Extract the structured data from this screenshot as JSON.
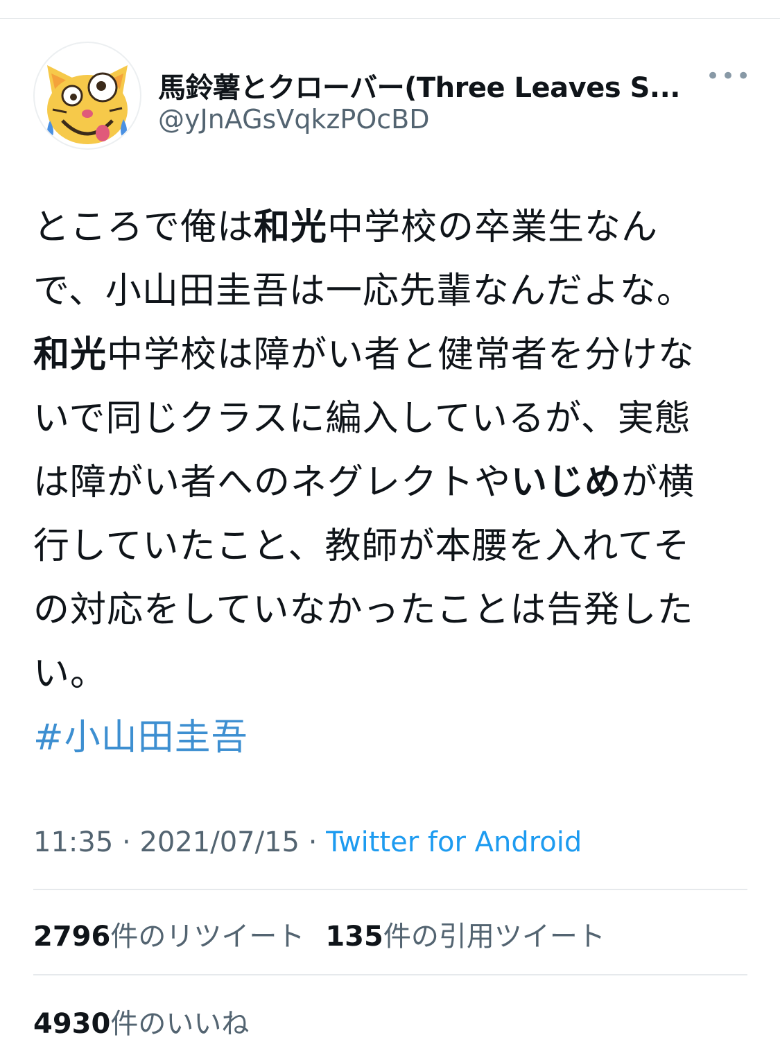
{
  "author": {
    "display_name": "馬鈴薯とクローバー(Three Leaves S...",
    "handle": "@yJnAGsVqkzPOcBD",
    "avatar_icon": "cat-face-tears-of-joy-icon"
  },
  "tweet": {
    "text_parts": {
      "p1": "ところで俺は",
      "b1": "和光",
      "p2": "中学校の卒業生なんで、小山田圭吾は一応先輩なんだよな。",
      "b2": "和光",
      "p3": "中学校は障がい者と健常者を分けないで同じクラスに編入しているが、実態は障がい者へのネグレクトや",
      "b3": "いじめ",
      "p4": "が横行していたこと、教師が本腰を入れてその対応をしていなかったことは告発したい。"
    },
    "hashtag": "#小山田圭吾"
  },
  "meta": {
    "time": "11:35",
    "separator": " · ",
    "date": "2021/07/15",
    "source": "Twitter for Android"
  },
  "stats": {
    "retweets_count": "2796",
    "retweets_label": "件のリツイート",
    "quotes_count": "135",
    "quotes_label": "件の引用ツイート",
    "likes_count": "4930",
    "likes_label": "件のいいね"
  },
  "colors": {
    "link": "#1d9bf0",
    "hashtag": "#3d8fd1",
    "secondary_text": "#536471",
    "primary_text": "#0f1419"
  }
}
